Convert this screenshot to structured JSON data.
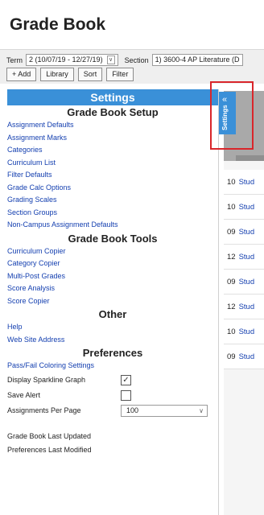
{
  "app": {
    "title": "Grade Book"
  },
  "toolbar": {
    "term_label": "Term",
    "term_value": "2 (10/07/19 - 12/27/19)",
    "section_label": "Section",
    "section_value": "1) 3600-4 AP Literature (D",
    "buttons": [
      "+ Add",
      "Library",
      "Sort",
      "Filter"
    ]
  },
  "settings": {
    "title": "Settings",
    "setup": {
      "heading": "Grade Book Setup",
      "links": [
        "Assignment Defaults",
        "Assignment Marks",
        "Categories",
        "Curriculum List",
        "Filter Defaults",
        "Grade Calc Options",
        "Grading Scales",
        "Section Groups",
        "Non-Campus Assignment Defaults"
      ]
    },
    "tools": {
      "heading": "Grade Book Tools",
      "links": [
        "Curriculum Copier",
        "Category Copier",
        "Multi-Post Grades",
        "Score Analysis",
        "Score Copier"
      ]
    },
    "other": {
      "heading": "Other",
      "links": [
        "Help",
        "Web Site Address"
      ]
    },
    "preferences": {
      "heading": "Preferences",
      "link": "Pass/Fail Coloring Settings",
      "sparkline_label": "Display Sparkline Graph",
      "sparkline_checked": true,
      "save_alert_label": "Save Alert",
      "save_alert_checked": false,
      "per_page_label": "Assignments Per Page",
      "per_page_value": "100"
    },
    "last_updated_label": "Grade Book Last Updated",
    "last_modified_label": "Preferences Last Modified"
  },
  "tab": {
    "label": "Settings",
    "arrow": "«"
  },
  "students": [
    {
      "grade": "10",
      "name": "Stud"
    },
    {
      "grade": "10",
      "name": "Stud"
    },
    {
      "grade": "09",
      "name": "Stud"
    },
    {
      "grade": "12",
      "name": "Stud"
    },
    {
      "grade": "09",
      "name": "Stud"
    },
    {
      "grade": "12",
      "name": "Stud"
    },
    {
      "grade": "10",
      "name": "Stud"
    },
    {
      "grade": "09",
      "name": "Stud"
    }
  ],
  "colors": {
    "accent": "#3a90d8",
    "link": "#1540b0",
    "highlight": "#d9262b"
  }
}
